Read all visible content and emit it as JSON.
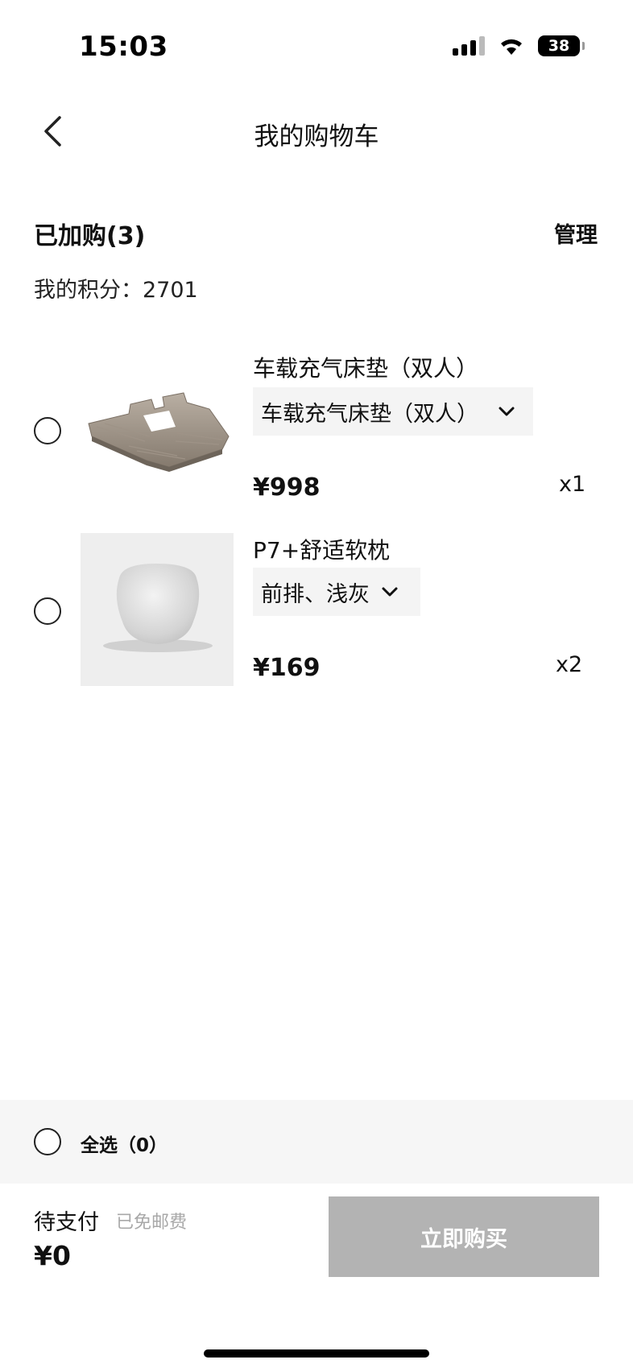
{
  "status_bar": {
    "time": "15:03",
    "battery": "38"
  },
  "nav": {
    "title": "我的购物车"
  },
  "summary": {
    "cart_count": "已加购(3)",
    "manage": "管理",
    "points": "我的积分：2701"
  },
  "items": [
    {
      "name": "车载充气床垫（双人）",
      "variant": "车载充气床垫（双人）",
      "price": "¥998",
      "qty": "x1"
    },
    {
      "name": "P7+舒适软枕",
      "variant": "前排、浅灰",
      "price": "¥169",
      "qty": "x2"
    }
  ],
  "footer": {
    "select_all": "全选（0）",
    "pending_label": "待支付",
    "shipping_note": "已免邮费",
    "total": "¥0",
    "buy_button": "立即购买"
  },
  "icons": {
    "back": "chevron-left-icon",
    "dropdown": "chevron-down-icon",
    "wifi": "wifi-icon",
    "signal": "signal-icon",
    "battery": "battery-icon"
  },
  "colors": {
    "buy_button_disabled": "#b3b3b3",
    "select_bar_bg": "#f6f6f6",
    "variant_bg": "#f4f4f4",
    "muted_text": "#a8a8a8"
  }
}
